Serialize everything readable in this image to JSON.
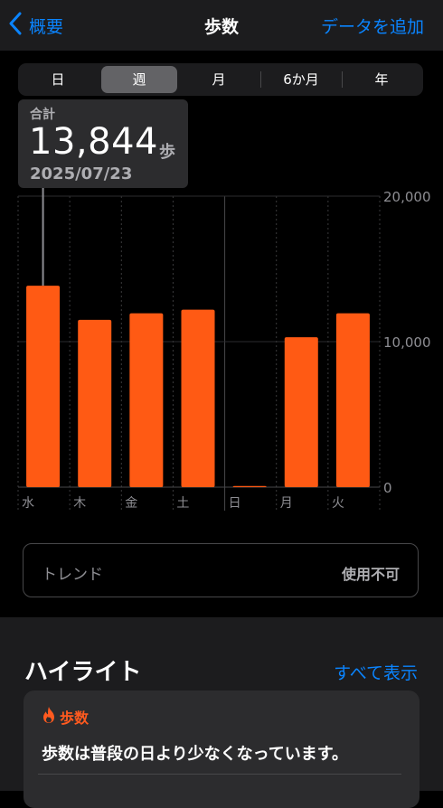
{
  "nav": {
    "back_label": "概要",
    "title": "歩数",
    "add_label": "データを追加"
  },
  "segments": [
    {
      "label": "日",
      "active": false
    },
    {
      "label": "週",
      "active": true
    },
    {
      "label": "月",
      "active": false
    },
    {
      "label": "6か月",
      "active": false
    },
    {
      "label": "年",
      "active": false
    }
  ],
  "tooltip": {
    "label": "合計",
    "value": "13,844",
    "unit": "歩",
    "date": "2025/07/23"
  },
  "chart_data": {
    "type": "bar",
    "categories": [
      "水",
      "木",
      "金",
      "土",
      "日",
      "月",
      "火"
    ],
    "values": [
      13844,
      11500,
      11950,
      12200,
      80,
      10300,
      11950
    ],
    "selected_index": 0,
    "ylim": [
      0,
      20000
    ],
    "yticks": [
      0,
      10000,
      20000
    ],
    "ytick_labels": [
      "0",
      "10,000",
      "20,000"
    ],
    "bar_color": "#ff5a14",
    "grid": true,
    "title": "",
    "xlabel": "",
    "ylabel": ""
  },
  "trend": {
    "label": "トレンド",
    "value": "使用不可"
  },
  "highlights": {
    "title": "ハイライト",
    "show_all": "すべて表示",
    "card": {
      "icon": "flame-icon",
      "category": "歩数",
      "text": "歩数は普段の日より少なくなっています。"
    }
  },
  "colors": {
    "accent": "#0a84ff",
    "steps": "#ff5a14"
  }
}
